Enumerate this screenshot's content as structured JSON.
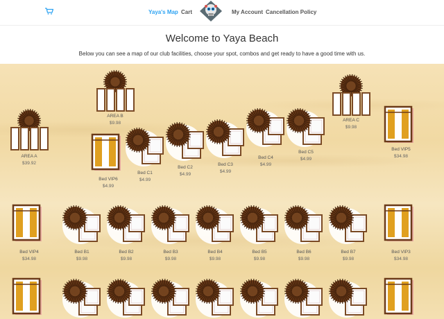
{
  "nav": {
    "cart_icon": "shopping-cart-icon",
    "links": [
      "Yaya's Map",
      "Cart",
      "My Account",
      "Cancellation Policy"
    ],
    "active": "Yaya's Map",
    "logo": "skull-logo"
  },
  "hero": {
    "title": "Welcome to Yaya Beach",
    "subtitle": "Below you can see a map of our club facilities, choose your spot, combos and get ready to have a good time with us."
  },
  "map": {
    "items": [
      {
        "label": "AREA B",
        "price": "$9.98",
        "kind": "area"
      },
      {
        "label": "AREA C",
        "price": "$9.98",
        "kind": "area"
      },
      {
        "label": "AREA A",
        "price": "$39.92",
        "kind": "area"
      },
      {
        "label": "Bed C1",
        "price": "$4.99",
        "kind": "bed"
      },
      {
        "label": "Bed C2",
        "price": "$4.99",
        "kind": "bed"
      },
      {
        "label": "Bed C3",
        "price": "$4.99",
        "kind": "bed"
      },
      {
        "label": "Bed C4",
        "price": "$4.99",
        "kind": "bed"
      },
      {
        "label": "Bed C5",
        "price": "$4.99",
        "kind": "bed"
      },
      {
        "label": "Bed VIP6",
        "price": "$4.99",
        "kind": "vip"
      },
      {
        "label": "Bed VIP5",
        "price": "$34.98",
        "kind": "vip"
      },
      {
        "label": "Bed VIP4",
        "price": "$34.98",
        "kind": "vip"
      },
      {
        "label": "Bed B1",
        "price": "$9.98",
        "kind": "bed"
      },
      {
        "label": "Bed B2",
        "price": "$9.98",
        "kind": "bed"
      },
      {
        "label": "Bed B3",
        "price": "$9.98",
        "kind": "bed"
      },
      {
        "label": "Bed B4",
        "price": "$9.98",
        "kind": "bed"
      },
      {
        "label": "Bed B5",
        "price": "$9.98",
        "kind": "bed"
      },
      {
        "label": "Bed B6",
        "price": "$9.98",
        "kind": "bed"
      },
      {
        "label": "Bed B7",
        "price": "$9.98",
        "kind": "bed"
      },
      {
        "label": "Bed VIP3",
        "price": "$34.98",
        "kind": "vip"
      }
    ],
    "bottom_row": [
      "vip",
      "bed",
      "bed",
      "bed",
      "bed",
      "bed",
      "bed",
      "bed",
      "vip"
    ]
  }
}
